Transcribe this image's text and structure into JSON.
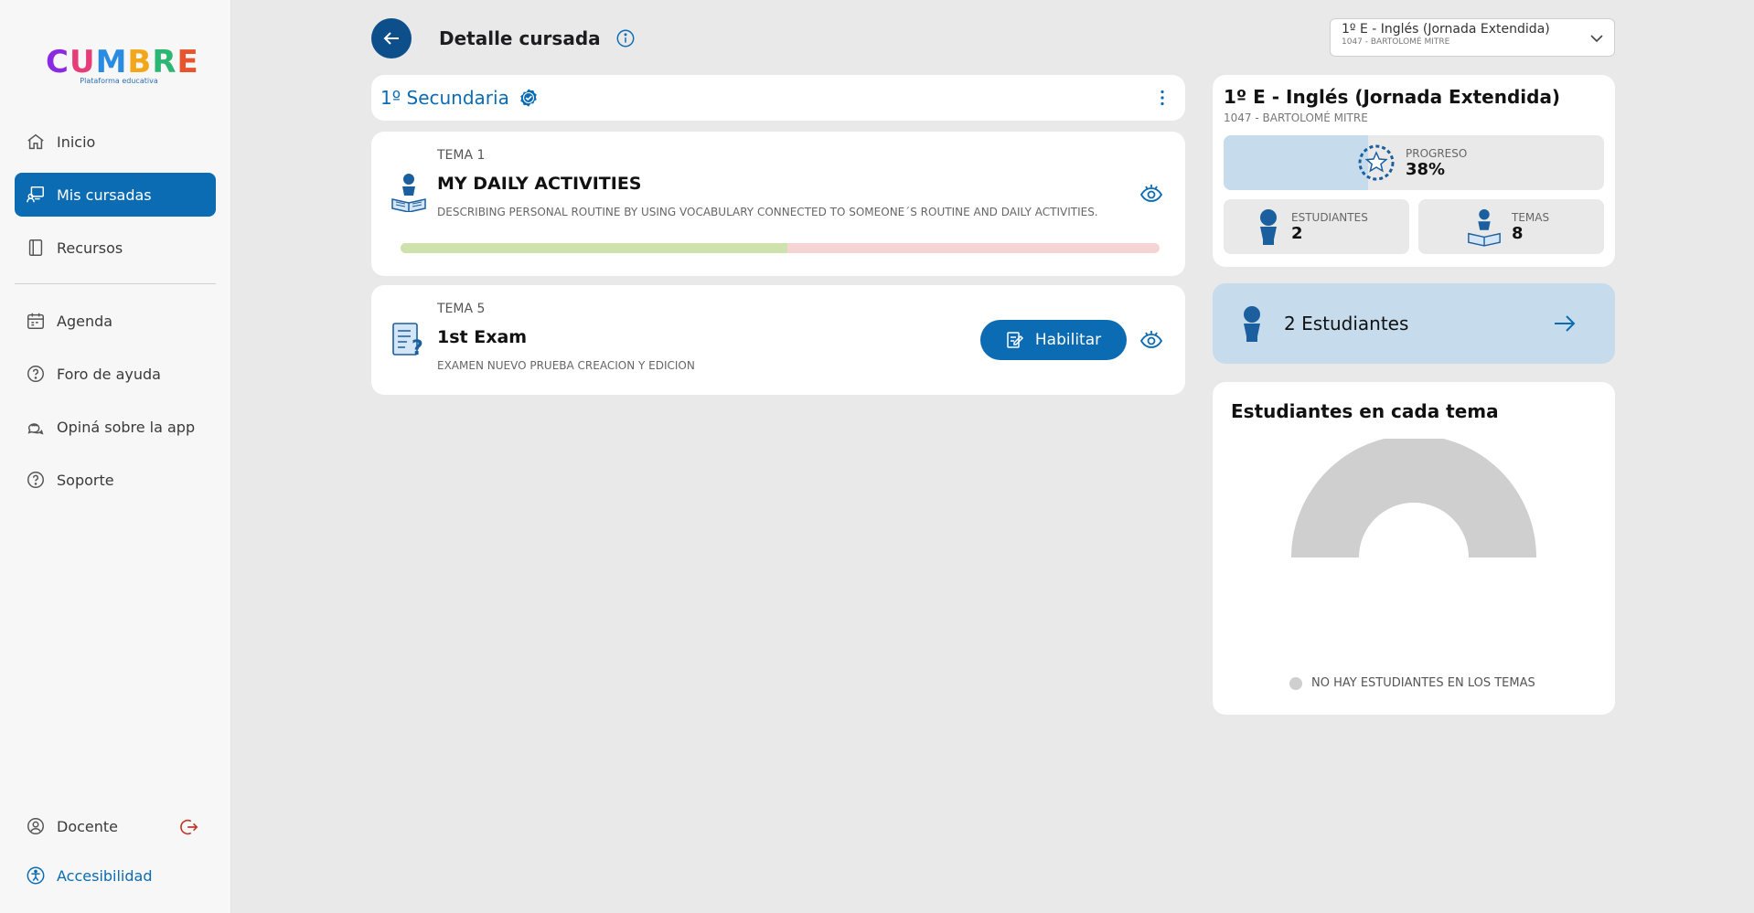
{
  "brand": {
    "name_letters": [
      "C",
      "U",
      "M",
      "B",
      "R",
      "E"
    ],
    "tagline": "Plataforma educativa"
  },
  "sidebar": {
    "items": [
      {
        "label": "Inicio",
        "icon": "home-icon"
      },
      {
        "label": "Mis cursadas",
        "icon": "classroom-icon",
        "active": true
      },
      {
        "label": "Recursos",
        "icon": "book-icon"
      },
      {
        "label": "Agenda",
        "icon": "calendar-icon"
      },
      {
        "label": "Foro de ayuda",
        "icon": "help-circle-icon"
      },
      {
        "label": "Opiná sobre la app",
        "icon": "chat-bubbles-icon"
      },
      {
        "label": "Soporte",
        "icon": "help-circle-icon"
      }
    ],
    "user_label": "Docente",
    "accessibility_label": "Accesibilidad"
  },
  "header": {
    "title": "Detalle cursada",
    "course_select": {
      "main": "1º E - Inglés (Jornada Extendida)",
      "sub": "1047 - BARTOLOMÉ MITRE"
    }
  },
  "section": {
    "title": "1º Secundaria"
  },
  "temas": [
    {
      "label": "TEMA 1",
      "name": "MY DAILY ACTIVITIES",
      "description": "DESCRIBING PERSONAL ROUTINE BY USING VOCABULARY CONNECTED TO SOMEONE´S ROUTINE AND DAILY ACTIVITIES.",
      "progress": 0.51
    },
    {
      "label": "TEMA 5",
      "name": "1st Exam",
      "description": "EXAMEN NUEVO PRUEBA CREACION Y EDICION",
      "button_label": "Habilitar"
    }
  ],
  "summary": {
    "title": "1º E - Inglés (Jornada Extendida)",
    "subtitle": "1047 - BARTOLOMÉ MITRE",
    "progress_label": "PROGRESO",
    "progress_value": "38%",
    "progress_fraction": 0.38,
    "students_label": "ESTUDIANTES",
    "students_value": "2",
    "temas_label": "TEMAS",
    "temas_value": "8"
  },
  "students_link": {
    "label": "2 Estudiantes"
  },
  "chart": {
    "title": "Estudiantes en cada tema",
    "legend_empty": "NO HAY ESTUDIANTES EN LOS TEMAS"
  },
  "colors": {
    "primary": "#0b6bb3",
    "dark_primary": "#0c4f8a",
    "progress_done": "#cfe1ad",
    "progress_remaining": "#f7d4d4",
    "students_card": "#c6dcec",
    "chart_empty": "#cfcfcf"
  }
}
